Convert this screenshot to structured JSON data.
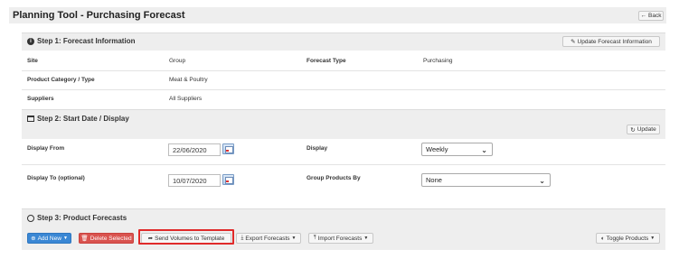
{
  "header": {
    "title": "Planning Tool - Purchasing Forecast",
    "back_label": "Back",
    "back_icon": "arrow-left-icon"
  },
  "step1": {
    "title": "Step 1: Forecast Information",
    "update_label": "Update Forecast Information",
    "rows": {
      "site_label": "Site",
      "site_value": "Group",
      "forecast_type_label": "Forecast Type",
      "forecast_type_value": "Purchasing",
      "category_label": "Product Category / Type",
      "category_value": "Meat & Poultry",
      "suppliers_label": "Suppliers",
      "suppliers_value": "All Suppliers"
    }
  },
  "step2": {
    "title": "Step 2: Start Date / Display",
    "update_label": "Update",
    "display_from_label": "Display From",
    "display_from_value": "22/06/2020",
    "display_to_label": "Display To (optional)",
    "display_to_value": "10/07/2020",
    "display_label": "Display",
    "display_value": "Weekly",
    "group_by_label": "Group Products By",
    "group_by_value": "None"
  },
  "step3": {
    "title": "Step 3: Product Forecasts",
    "add_new_label": "Add New",
    "delete_label": "Delete Selected",
    "send_label": "Send Volumes to Template",
    "export_label": "Export Forecasts",
    "import_label": "Import Forecasts",
    "toggle_label": "Toggle Products"
  },
  "colors": {
    "primary": "#3a87d4",
    "danger": "#d9534f",
    "highlight": "#e02a2a",
    "panel": "#eeeeee"
  }
}
